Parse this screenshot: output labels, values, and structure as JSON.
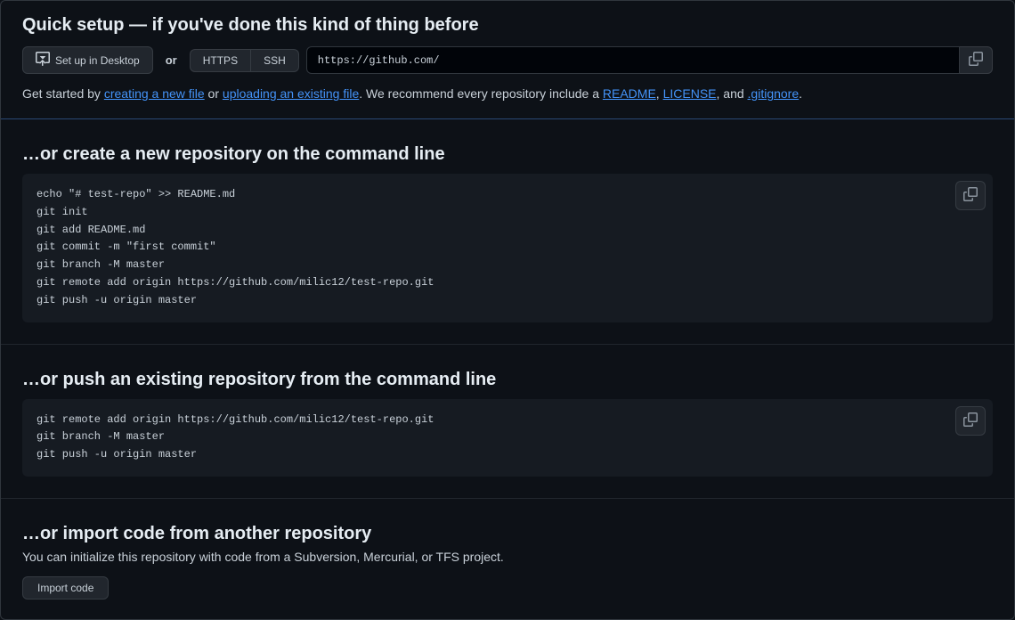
{
  "quickSetup": {
    "heading": "Quick setup — if you've done this kind of thing before",
    "desktopBtn": "Set up in Desktop",
    "orText": "or",
    "httpsBtn": "HTTPS",
    "sshBtn": "SSH",
    "cloneUrl": "https://github.com/",
    "helpPrefix": "Get started by ",
    "createFileLink": "creating a new file",
    "helpOr": " or ",
    "uploadFileLink": "uploading an existing file",
    "helpMid": ". We recommend every repository include a ",
    "readmeLink": "README",
    "comma1": ", ",
    "licenseLink": "LICENSE",
    "comma2": ", and ",
    "gitignoreLink": ".gitignore",
    "period": "."
  },
  "createRepo": {
    "heading": "…or create a new repository on the command line",
    "code": "echo \"# test-repo\" >> README.md\ngit init\ngit add README.md\ngit commit -m \"first commit\"\ngit branch -M master\ngit remote add origin https://github.com/milic12/test-repo.git\ngit push -u origin master"
  },
  "pushRepo": {
    "heading": "…or push an existing repository from the command line",
    "code": "git remote add origin https://github.com/milic12/test-repo.git\ngit branch -M master\ngit push -u origin master"
  },
  "importRepo": {
    "heading": "…or import code from another repository",
    "desc": "You can initialize this repository with code from a Subversion, Mercurial, or TFS project.",
    "btn": "Import code"
  }
}
